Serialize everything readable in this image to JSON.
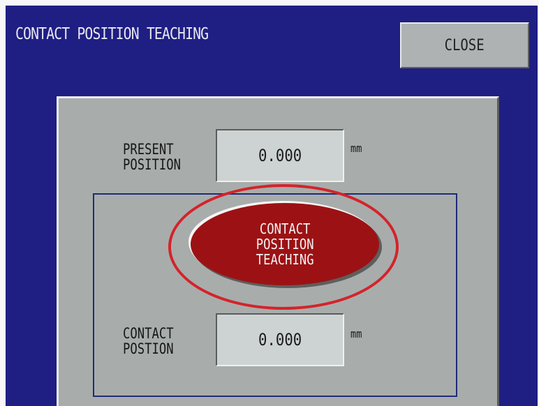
{
  "window": {
    "title": "CONTACT POSITION TEACHING"
  },
  "toolbar": {
    "close_label": "CLOSE"
  },
  "present_position": {
    "label": "PRESENT\nPOSITION",
    "value": "0.000",
    "unit": "mm"
  },
  "teach_button": {
    "label": "CONTACT\nPOSITION\nTEACHING"
  },
  "contact_position": {
    "label": "CONTACT\nPOSTION",
    "value": "0.000",
    "unit": "mm"
  },
  "colors": {
    "background": "#1f1e83",
    "panel": "#a8adab",
    "button": "#9c1214",
    "highlight": "#d4232b"
  }
}
